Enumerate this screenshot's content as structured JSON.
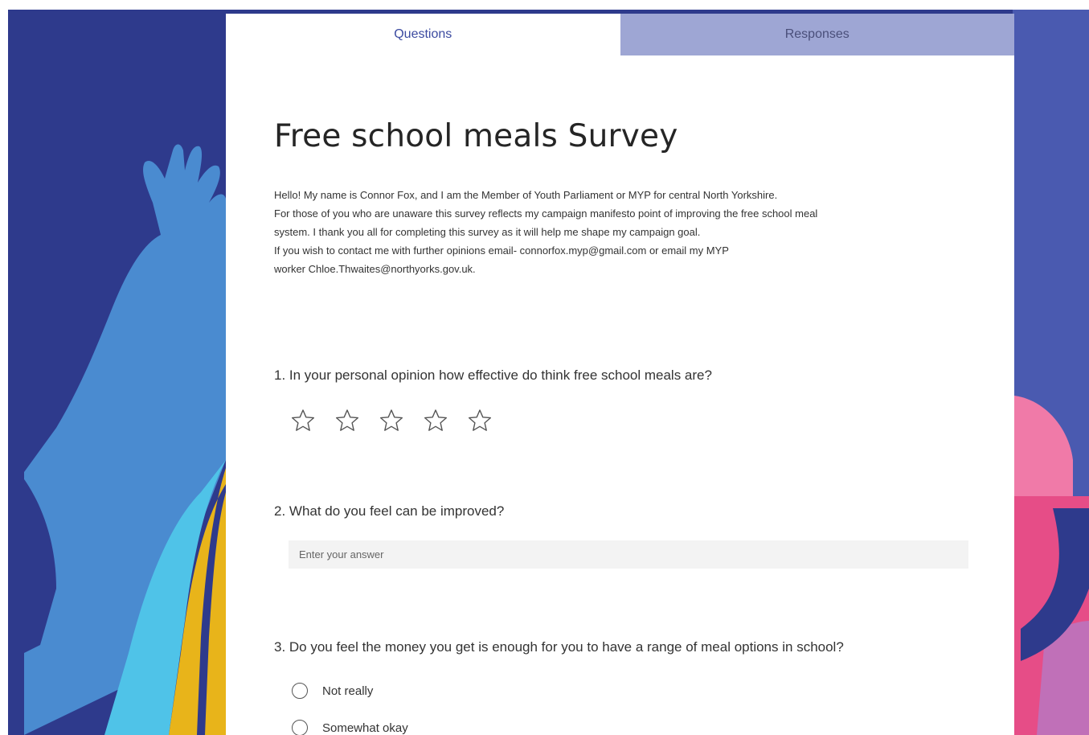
{
  "tabs": {
    "questions_label": "Questions",
    "responses_label": "Responses"
  },
  "form": {
    "title": "Free school meals Survey",
    "description_lines": [
      "Hello! My name is Connor Fox, and I am the Member of Youth Parliament or MYP for central North Yorkshire.",
      "For those of you who are unaware this survey reflects my campaign manifesto point of improving the free school meal",
      "system. I thank you all for completing this survey as it will help me shape my campaign goal.",
      "If you wish to contact me with further opinions email- connorfox.myp@gmail.com or email my MYP",
      "worker Chloe.Thwaites@northyorks.gov.uk."
    ]
  },
  "questions": [
    {
      "text": "1. In your personal opinion how effective do think free school meals are?",
      "type": "rating",
      "rating_max": 5,
      "rating_value": 0
    },
    {
      "text": "2. What do you feel can be improved?",
      "type": "text",
      "placeholder": "Enter your answer"
    },
    {
      "text": "3. Do you feel the money you get is enough for you to have a range of meal options in school?",
      "type": "choice",
      "options": [
        "Not really",
        "Somewhat okay"
      ]
    }
  ],
  "colors": {
    "accent": "#3b4aa0",
    "inactive_tab": "#9ea6d4",
    "background_navy": "#2e3a8c",
    "background_blue": "#4a5ab0",
    "figure_light_blue": "#4a8bd0",
    "figure_cyan": "#4fc3e8",
    "figure_yellow": "#e8b41a",
    "figure_pink": "#f07aa8",
    "figure_magenta": "#e64d87"
  }
}
